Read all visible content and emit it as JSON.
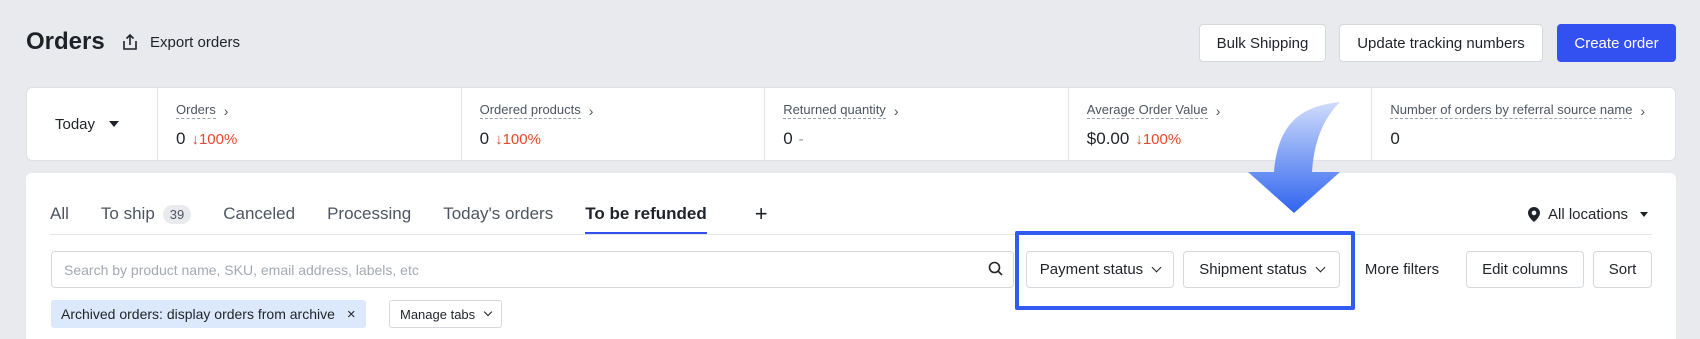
{
  "header": {
    "title": "Orders",
    "export_label": "Export orders",
    "bulk_shipping_label": "Bulk Shipping",
    "update_tracking_label": "Update tracking numbers",
    "create_order_label": "Create order"
  },
  "stats": {
    "period": "Today",
    "items": [
      {
        "label": "Orders",
        "value": "0",
        "delta": "100%",
        "delta_dir": "down"
      },
      {
        "label": "Ordered products",
        "value": "0",
        "delta": "100%",
        "delta_dir": "down"
      },
      {
        "label": "Returned quantity",
        "value": "0",
        "delta": "-",
        "delta_dir": "flat"
      },
      {
        "label": "Average Order Value",
        "value": "$0.00",
        "delta": "100%",
        "delta_dir": "down"
      },
      {
        "label": "Number of orders by referral source name",
        "value": "0"
      }
    ]
  },
  "tabs": {
    "items": [
      {
        "label": "All"
      },
      {
        "label": "To ship",
        "badge": "39"
      },
      {
        "label": "Canceled"
      },
      {
        "label": "Processing"
      },
      {
        "label": "Today's orders"
      },
      {
        "label": "To be refunded",
        "active": true
      }
    ],
    "add_label": "+",
    "locations_label": "All locations"
  },
  "filters": {
    "search_placeholder": "Search by product name, SKU, email address, labels, etc",
    "payment_status_label": "Payment status",
    "shipment_status_label": "Shipment status",
    "more_filters_label": "More filters",
    "edit_columns_label": "Edit columns",
    "sort_label": "Sort",
    "archived_chip_label": "Archived orders: display orders from archive",
    "chip_close": "×",
    "manage_tabs_label": "Manage tabs"
  },
  "colors": {
    "accent": "#3350f0",
    "negative": "#e5482d",
    "highlight": "#2f5bf1",
    "chip_bg": "#dce8fb"
  }
}
